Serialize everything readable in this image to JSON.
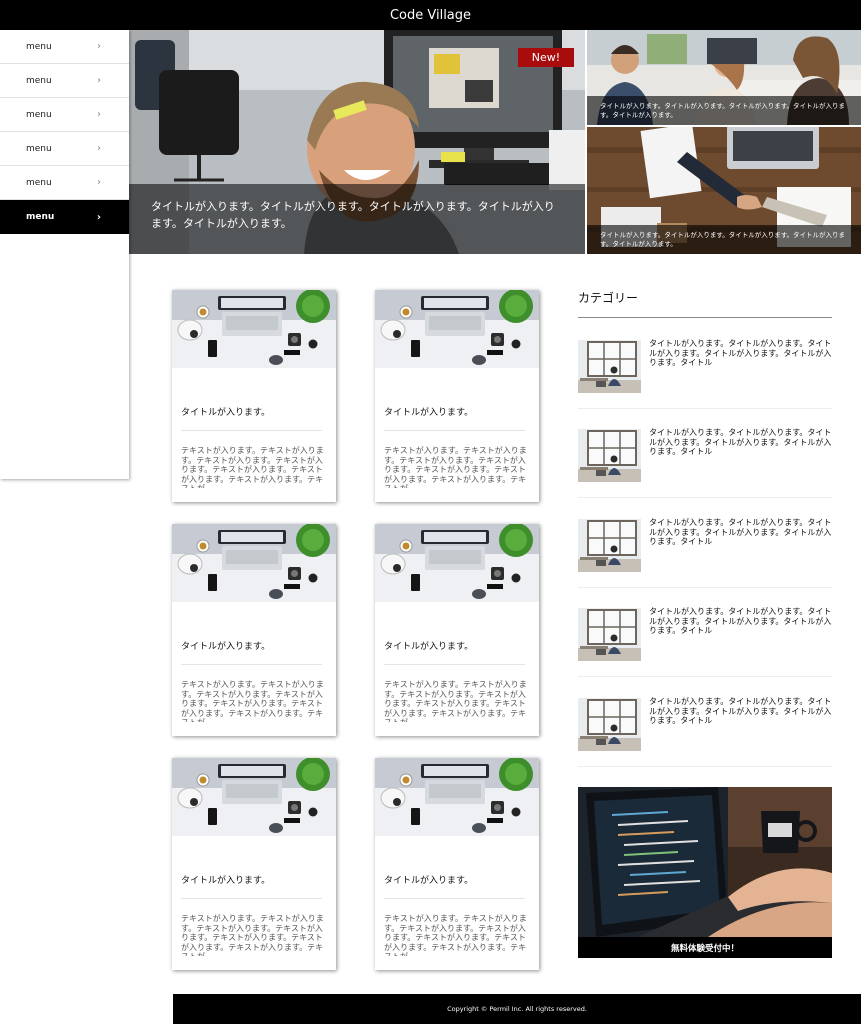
{
  "app": {
    "title": "Code Village"
  },
  "sidebar": {
    "items": [
      {
        "label": "menu"
      },
      {
        "label": "menu"
      },
      {
        "label": "menu"
      },
      {
        "label": "menu"
      },
      {
        "label": "menu"
      },
      {
        "label": "menu"
      }
    ]
  },
  "hero": {
    "badge": "New!",
    "caption": "タイトルが入ります。タイトルが入ります。タイトルが入ります。タイトルが入ります。タイトルが入ります。"
  },
  "side_features": [
    {
      "caption": "タイトルが入ります。タイトルが入ります。タイトルが入ります。タイトルが入ります。タイトルが入ります。"
    },
    {
      "caption": "タイトルが入ります。タイトルが入ります。タイトルが入ります。タイトルが入ります。タイトルが入ります。"
    }
  ],
  "articles": [
    {
      "title": "タイトルが入ります。",
      "text": "テキストが入ります。テキストが入ります。テキストが入ります。テキストが入ります。テキストが入ります。テキストが入ります。テキストが入ります。テキストが"
    },
    {
      "title": "タイトルが入ります。",
      "text": "テキストが入ります。テキストが入ります。テキストが入ります。テキストが入ります。テキストが入ります。テキストが入ります。テキストが入ります。テキストが"
    },
    {
      "title": "タイトルが入ります。",
      "text": "テキストが入ります。テキストが入ります。テキストが入ります。テキストが入ります。テキストが入ります。テキストが入ります。テキストが入ります。テキストが"
    },
    {
      "title": "タイトルが入ります。",
      "text": "テキストが入ります。テキストが入ります。テキストが入ります。テキストが入ります。テキストが入ります。テキストが入ります。テキストが入ります。テキストが"
    },
    {
      "title": "タイトルが入ります。",
      "text": "テキストが入ります。テキストが入ります。テキストが入ります。テキストが入ります。テキストが入ります。テキストが入ります。テキストが入ります。テキストが"
    },
    {
      "title": "タイトルが入ります。",
      "text": "テキストが入ります。テキストが入ります。テキストが入ります。テキストが入ります。テキストが入ります。テキストが入ります。テキストが入ります。テキストが"
    }
  ],
  "category": {
    "heading": "カテゴリー",
    "items": [
      {
        "text": "タイトルが入ります。タイトルが入ります。タイトルが入ります。タイトルが入ります。タイトルが入ります。タイトル"
      },
      {
        "text": "タイトルが入ります。タイトルが入ります。タイトルが入ります。タイトルが入ります。タイトルが入ります。タイトル"
      },
      {
        "text": "タイトルが入ります。タイトルが入ります。タイトルが入ります。タイトルが入ります。タイトルが入ります。タイトル"
      },
      {
        "text": "タイトルが入ります。タイトルが入ります。タイトルが入ります。タイトルが入ります。タイトルが入ります。タイトル"
      },
      {
        "text": "タイトルが入ります。タイトルが入ります。タイトルが入ります。タイトルが入ります。タイトルが入ります。タイトル"
      }
    ]
  },
  "banner": {
    "caption": "無料体験受付中！"
  },
  "footer": {
    "copyright": "Copyright © Permil Inc. All rights reserved."
  },
  "colors": {
    "header_bg": "#000000",
    "badge_bg": "#a80c0c",
    "active_menu_bg": "#000000"
  }
}
